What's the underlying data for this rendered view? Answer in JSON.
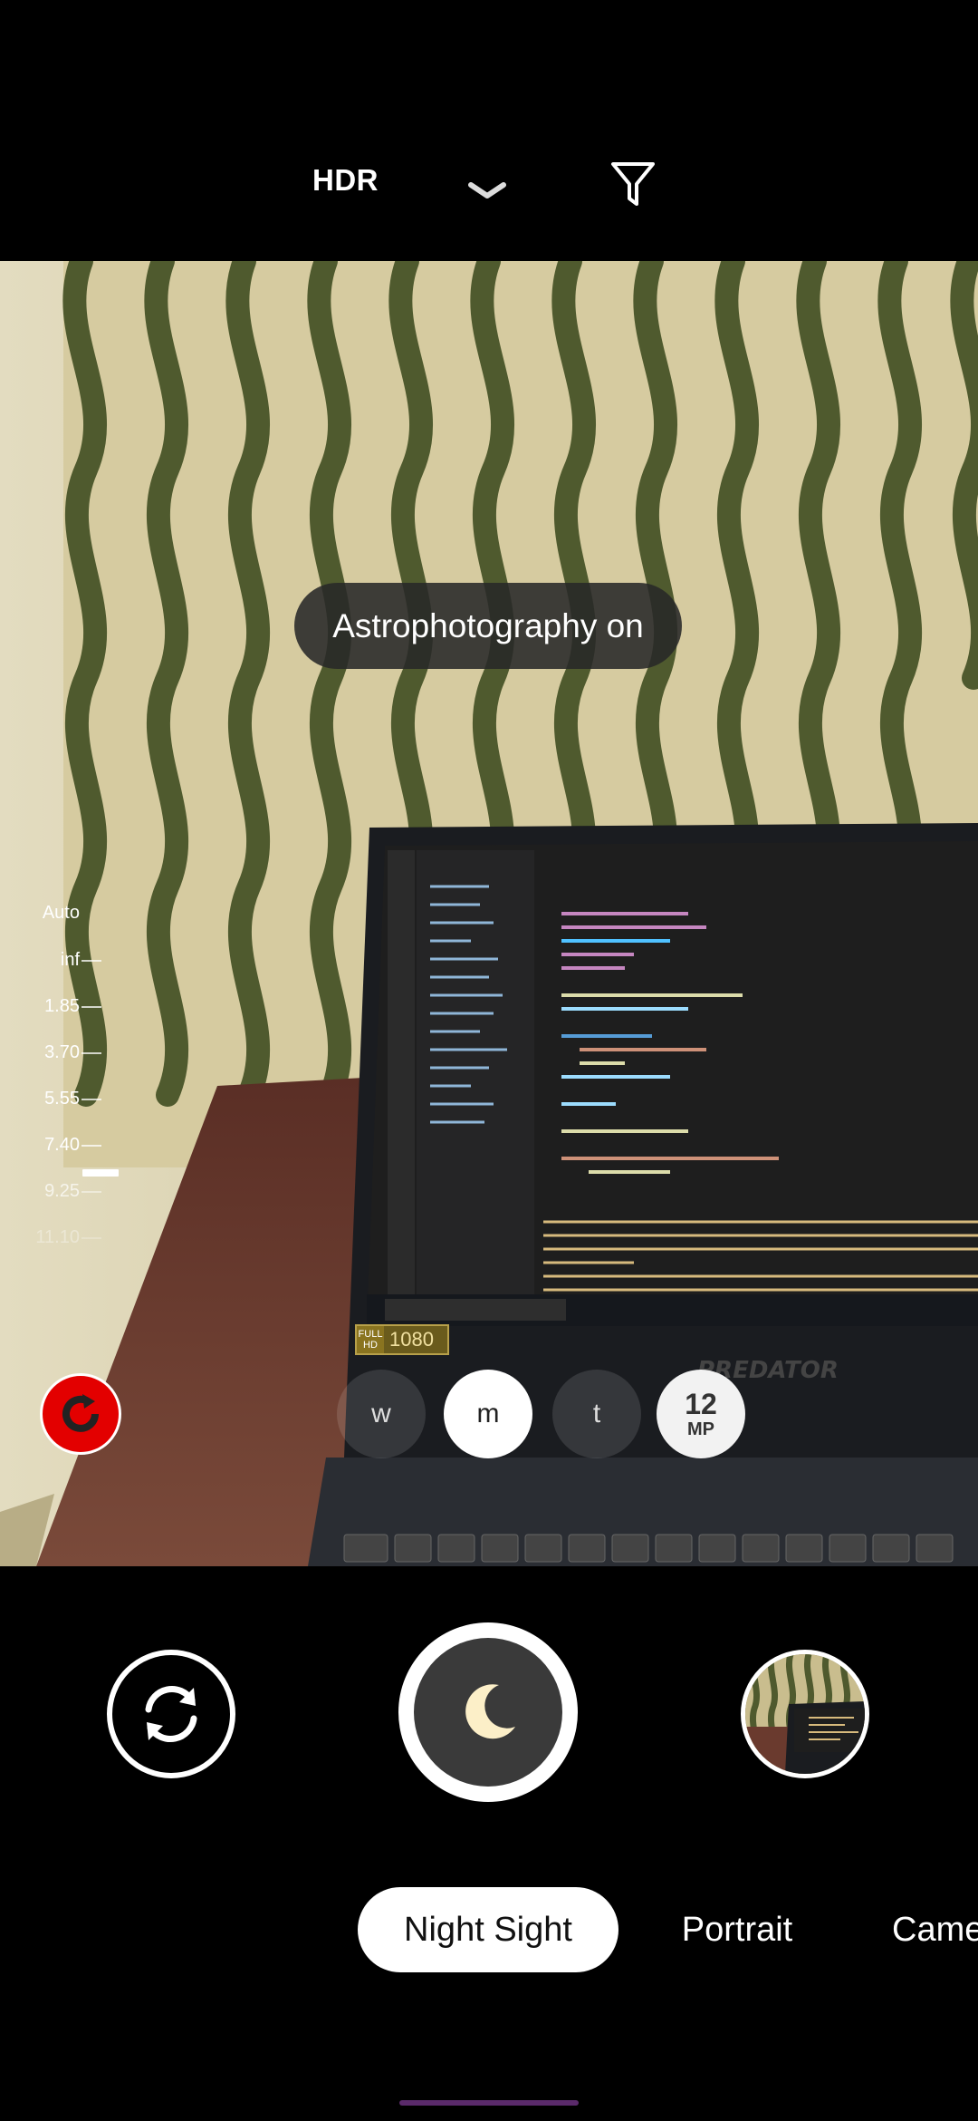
{
  "topbar": {
    "hdr_label": "HDR",
    "expand_icon": "chevron-down",
    "filter_icon": "filter"
  },
  "viewfinder": {
    "toast": "Astrophotography on",
    "focus_scale": [
      "Auto",
      "inf",
      "1.85",
      "3.70",
      "5.55",
      "7.40",
      "9.25",
      "11.10"
    ],
    "resolution_badge": {
      "top": "FULL HD",
      "value": "1080"
    },
    "zoom_options": [
      {
        "label": "w",
        "selected": false
      },
      {
        "label": "m",
        "selected": true
      },
      {
        "label": "t",
        "selected": false
      }
    ],
    "megapixels": {
      "value": "12",
      "unit": "MP"
    }
  },
  "controls": {
    "flip_icon": "camera-switch",
    "shutter_icon": "moon",
    "thumbnail_icon": "gallery-thumbnail"
  },
  "modes": [
    {
      "label": "Night Sight",
      "selected": true
    },
    {
      "label": "Portrait",
      "selected": false
    },
    {
      "label": "Came",
      "selected": false
    }
  ],
  "colors": {
    "accent_red": "#e30000",
    "shutter_inner": "#3a3a3a",
    "moon": "#fcefc8"
  }
}
